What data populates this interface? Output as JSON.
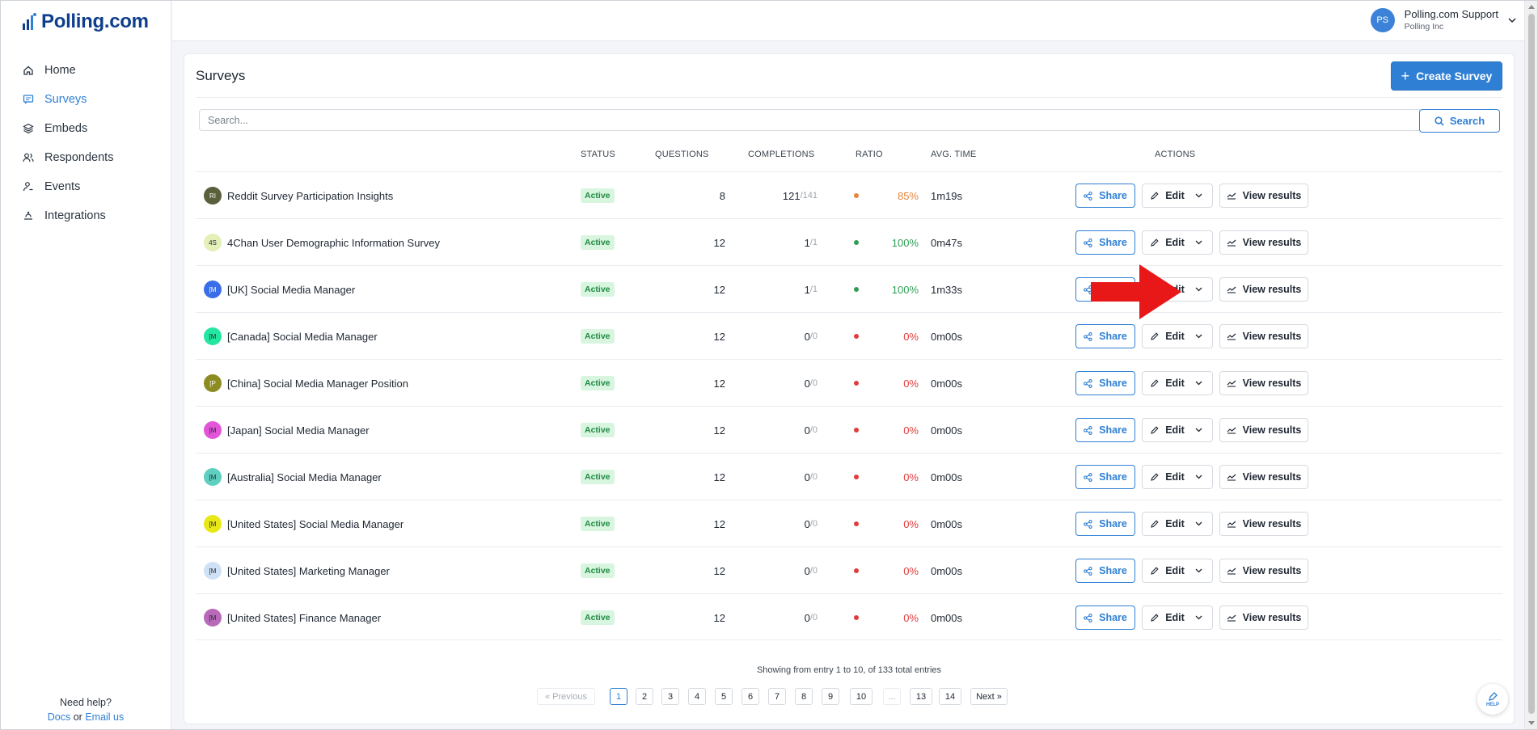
{
  "app": {
    "name": "Polling.com"
  },
  "sidebar": {
    "items": [
      {
        "label": "Home",
        "icon": "home-icon",
        "active": false
      },
      {
        "label": "Surveys",
        "icon": "chat-icon",
        "active": true
      },
      {
        "label": "Embeds",
        "icon": "layers-icon",
        "active": false
      },
      {
        "label": "Respondents",
        "icon": "users-icon",
        "active": false
      },
      {
        "label": "Events",
        "icon": "person-event-icon",
        "active": false
      },
      {
        "label": "Integrations",
        "icon": "integration-icon",
        "active": false
      }
    ],
    "help": {
      "title": "Need help?",
      "docs": "Docs",
      "or": "or",
      "email": "Email us"
    }
  },
  "user": {
    "initials": "PS",
    "name": "Polling.com Support",
    "org": "Polling Inc"
  },
  "page": {
    "title": "Surveys",
    "create_label": "Create Survey",
    "search_placeholder": "Search...",
    "search_label": "Search"
  },
  "table": {
    "headers": {
      "status": "STATUS",
      "questions": "QUESTIONS",
      "completions": "COMPLETIONS",
      "ratio": "RATIO",
      "avg_time": "AVG. TIME",
      "actions": "ACTIONS"
    },
    "action_labels": {
      "share": "Share",
      "edit": "Edit",
      "view": "View results"
    },
    "rows": [
      {
        "initials": "RI",
        "avatar_color": "#5a5f3c",
        "avatar_text_color": "#ffffff",
        "name": "Reddit Survey Participation Insights",
        "status": "Active",
        "questions": "8",
        "completed": "121",
        "total": "/141",
        "ratio": "85%",
        "ratio_color": "#e8843a",
        "avg_time": "1m19s"
      },
      {
        "initials": "4S",
        "avatar_color": "#e4f0b8",
        "avatar_text_color": "#1f2733",
        "name": "4Chan User Demographic Information Survey",
        "status": "Active",
        "questions": "12",
        "completed": "1",
        "total": "/1",
        "ratio": "100%",
        "ratio_color": "#2f9e55",
        "avg_time": "0m47s"
      },
      {
        "initials": "[M",
        "avatar_color": "#3a6ee8",
        "avatar_text_color": "#ffffff",
        "name": "[UK] Social Media Manager",
        "status": "Active",
        "questions": "12",
        "completed": "1",
        "total": "/1",
        "ratio": "100%",
        "ratio_color": "#2f9e55",
        "avg_time": "1m33s"
      },
      {
        "initials": "[M",
        "avatar_color": "#23e6a0",
        "avatar_text_color": "#1f2733",
        "name": "[Canada] Social Media Manager",
        "status": "Active",
        "questions": "12",
        "completed": "0",
        "total": "/0",
        "ratio": "0%",
        "ratio_color": "#e23b3b",
        "avg_time": "0m00s"
      },
      {
        "initials": "[P",
        "avatar_color": "#8c8c22",
        "avatar_text_color": "#ffffff",
        "name": "[China] Social Media Manager Position",
        "status": "Active",
        "questions": "12",
        "completed": "0",
        "total": "/0",
        "ratio": "0%",
        "ratio_color": "#e23b3b",
        "avg_time": "0m00s"
      },
      {
        "initials": "[M",
        "avatar_color": "#e255d8",
        "avatar_text_color": "#1f2733",
        "name": "[Japan] Social Media Manager",
        "status": "Active",
        "questions": "12",
        "completed": "0",
        "total": "/0",
        "ratio": "0%",
        "ratio_color": "#e23b3b",
        "avg_time": "0m00s"
      },
      {
        "initials": "[M",
        "avatar_color": "#5fcfc0",
        "avatar_text_color": "#1f2733",
        "name": "[Australia] Social Media Manager",
        "status": "Active",
        "questions": "12",
        "completed": "0",
        "total": "/0",
        "ratio": "0%",
        "ratio_color": "#e23b3b",
        "avg_time": "0m00s"
      },
      {
        "initials": "[M",
        "avatar_color": "#e8e817",
        "avatar_text_color": "#1f2733",
        "name": "[United States] Social Media Manager",
        "status": "Active",
        "questions": "12",
        "completed": "0",
        "total": "/0",
        "ratio": "0%",
        "ratio_color": "#e23b3b",
        "avg_time": "0m00s"
      },
      {
        "initials": "[M",
        "avatar_color": "#cfe1f5",
        "avatar_text_color": "#1f2733",
        "name": "[United States] Marketing Manager",
        "status": "Active",
        "questions": "12",
        "completed": "0",
        "total": "/0",
        "ratio": "0%",
        "ratio_color": "#e23b3b",
        "avg_time": "0m00s"
      },
      {
        "initials": "[M",
        "avatar_color": "#b86ab8",
        "avatar_text_color": "#1f2733",
        "name": "[United States] Finance Manager",
        "status": "Active",
        "questions": "12",
        "completed": "0",
        "total": "/0",
        "ratio": "0%",
        "ratio_color": "#e23b3b",
        "avg_time": "0m00s"
      }
    ]
  },
  "pagination": {
    "summary": "Showing from entry 1 to 10, of 133 total entries",
    "previous": "« Previous",
    "next": "Next »",
    "pages": [
      "1",
      "2",
      "3",
      "4",
      "5",
      "6",
      "7",
      "8",
      "9",
      "10",
      "...",
      "13",
      "14"
    ],
    "current": "1"
  },
  "help_bubble": {
    "label": "HELP"
  },
  "colors": {
    "accent": "#2f80d4",
    "brand": "#0f3f8c",
    "active_badge_bg": "#d8f5df",
    "annotation_arrow": "#e81818"
  }
}
